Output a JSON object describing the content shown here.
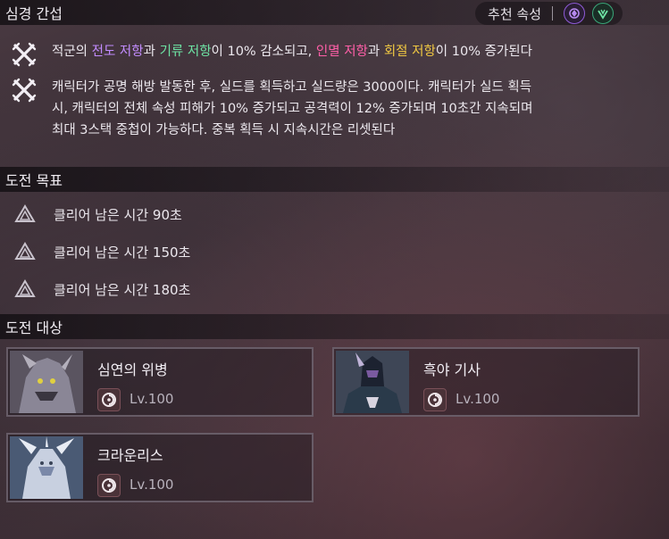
{
  "header": {
    "title": "심경 간섭",
    "recommended_label": "추천 속성",
    "elements": [
      {
        "icon": "purple-element-icon",
        "color": "#8f5bd8"
      },
      {
        "icon": "green-element-icon",
        "color": "#3aa87a"
      }
    ]
  },
  "effects": [
    {
      "icon": "crossed-swords-icon",
      "parts": [
        {
          "text": "적군의 ",
          "color": "default"
        },
        {
          "text": "전도 저항",
          "color": "purple"
        },
        {
          "text": "과 ",
          "color": "default"
        },
        {
          "text": "기류 저항",
          "color": "green"
        },
        {
          "text": "이 10% 감소되고, ",
          "color": "default"
        },
        {
          "text": "인멸 저항",
          "color": "pink"
        },
        {
          "text": "과 ",
          "color": "default"
        },
        {
          "text": "회절 저항",
          "color": "gold"
        },
        {
          "text": "이 10% 증가된다",
          "color": "default"
        }
      ]
    },
    {
      "icon": "crossed-swords-icon",
      "lines": [
        "캐릭터가 공명 해방 발동한 후, 실드를 획득하고 실드량은 3000이다. 캐릭터가 실드 획득",
        "시, 캐릭터의 전체 속성 피해가 10% 증가되고 공격력이 12% 증가되며 10초간 지속되며",
        "최대 3스택 중첩이 가능하다. 중복 획득 시 지속시간은 리셋된다"
      ]
    }
  ],
  "goals_section": {
    "title": "도전 목표",
    "items": [
      "클리어 남은 시간 90초",
      "클리어 남은 시간 150초",
      "클리어 남은 시간 180초"
    ]
  },
  "targets_section": {
    "title": "도전 대상",
    "cards": [
      {
        "name": "심연의 위병",
        "level": "Lv.100"
      },
      {
        "name": "흑야 기사",
        "level": "Lv.100"
      },
      {
        "name": "크라운리스",
        "level": "Lv.100"
      }
    ]
  },
  "colors": {
    "purple": "#c28cff",
    "green": "#6ee3a4",
    "pink": "#ff5fa8",
    "gold": "#f0c842"
  }
}
